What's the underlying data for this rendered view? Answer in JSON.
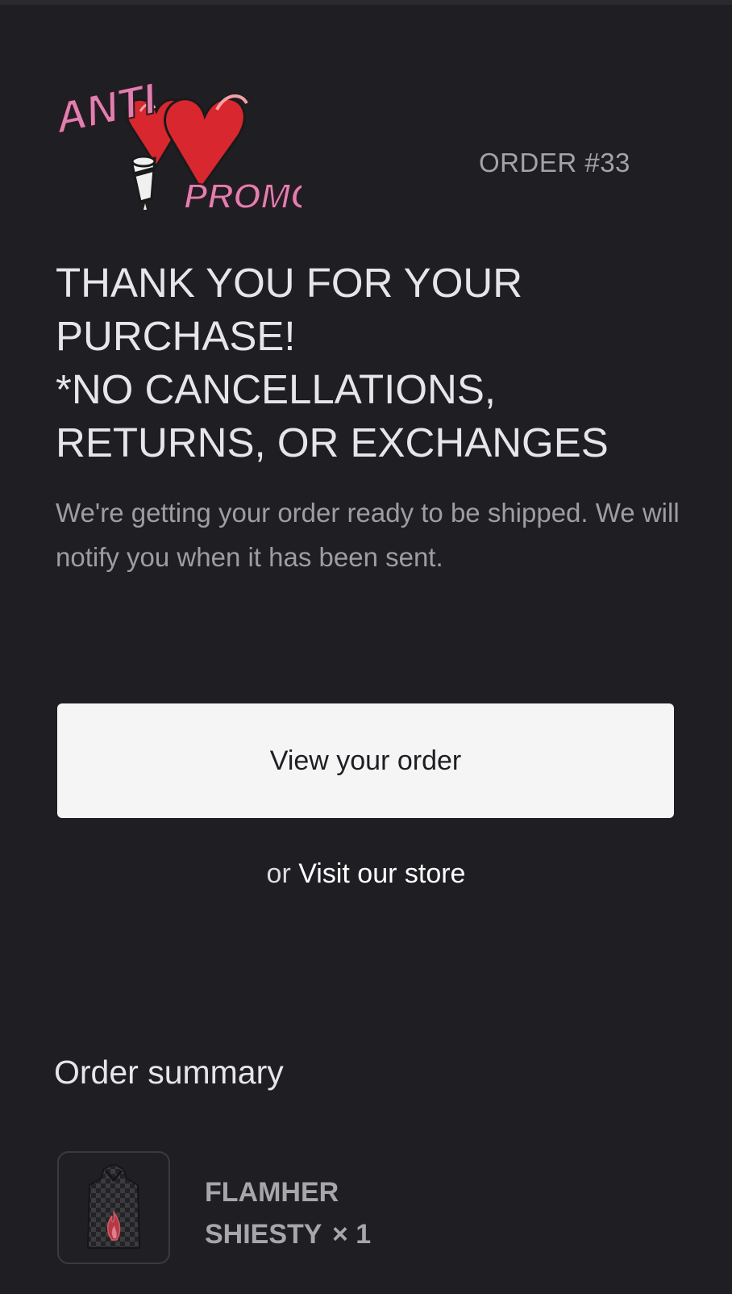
{
  "logo": {
    "alt": "ANTI PROMO",
    "word_top": "ANTI",
    "word_bottom": "PROMO",
    "colors": {
      "pink": "#e07fb0",
      "red": "#d8272e"
    }
  },
  "order": {
    "number_label": "ORDER #33"
  },
  "headline": "THANK YOU FOR YOUR\nPURCHASE!\n*NO CANCELLATIONS,\nRETURNS, OR EXCHANGES",
  "message": "We're getting your order ready to be shipped. We will notify you when it has been sent.",
  "actions": {
    "view_order_label": "View your order",
    "or_text": "or",
    "visit_store_label": "Visit our store"
  },
  "summary": {
    "heading": "Order summary",
    "items": [
      {
        "name": "FLAMHER SHIESTY",
        "quantity_label": "× 1",
        "thumbnail_icon": "checkered-hoodie-flame-image"
      }
    ]
  },
  "theme": {
    "background": "#1f1f23",
    "button_background": "#f5f5f5"
  }
}
